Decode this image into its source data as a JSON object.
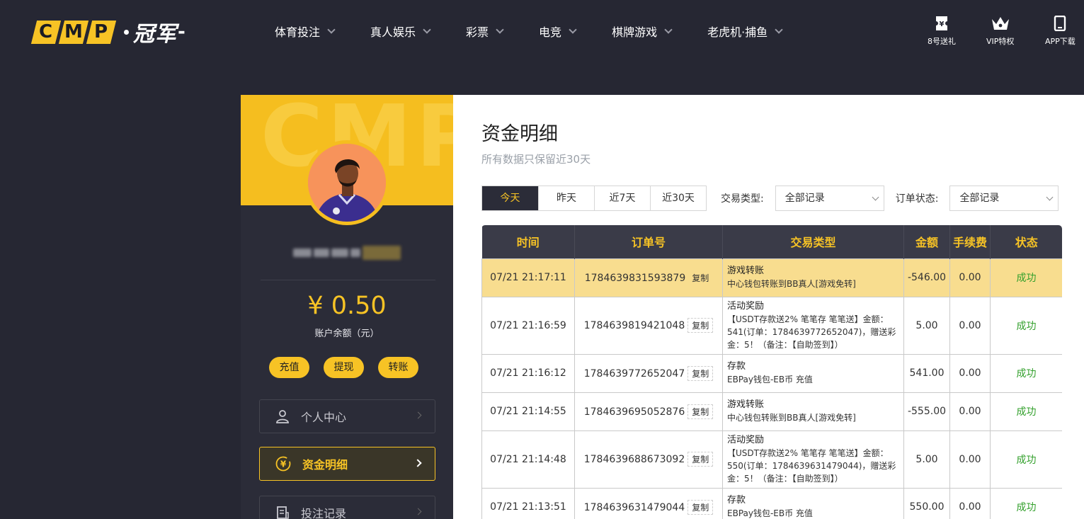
{
  "brand": {
    "letters": [
      "C",
      "M",
      "P"
    ],
    "cn": "冠军"
  },
  "nav": [
    {
      "label": "体育投注"
    },
    {
      "label": "真人娱乐"
    },
    {
      "label": "彩票"
    },
    {
      "label": "电竞"
    },
    {
      "label": "棋牌游戏"
    },
    {
      "label": "老虎机·捕鱼"
    }
  ],
  "quick": {
    "gift": "8号送礼",
    "vip": "VIP特权",
    "app": "APP下载"
  },
  "sidebar": {
    "hero_text": "CMP",
    "balance": "¥ 0.50",
    "balance_label": "账户余额（元）",
    "buttons": {
      "deposit": "充值",
      "withdraw": "提现",
      "transfer": "转账"
    },
    "menu": [
      {
        "label": "个人中心"
      },
      {
        "label": "资金明细"
      },
      {
        "label": "投注记录"
      }
    ]
  },
  "main": {
    "title": "资金明细",
    "subtitle": "所有数据只保留近30天",
    "tabs": [
      "今天",
      "昨天",
      "近7天",
      "近30天"
    ],
    "type_label": "交易类型:",
    "type_value": "全部记录",
    "status_label": "订单状态:",
    "status_value": "全部记录",
    "columns": [
      "时间",
      "订单号",
      "交易类型",
      "金额",
      "手续费",
      "状态"
    ],
    "copy_label": "复制",
    "rows": [
      {
        "time": "07/21 21:17:11",
        "order": "1784639831593879",
        "type": "游戏转账",
        "desc": "中心钱包转账到BB真人[游戏免转]",
        "amount": "-546.00",
        "fee": "0.00",
        "status": "成功"
      },
      {
        "time": "07/21 21:16:59",
        "order": "1784639819421048",
        "type": "活动奖励",
        "desc": "【USDT存款送2% 笔笔存 笔笔送】金额：541(订单：1784639772652047)，赠送彩金：5！（备注：【自助签到】）",
        "amount": "5.00",
        "fee": "0.00",
        "status": "成功"
      },
      {
        "time": "07/21 21:16:12",
        "order": "1784639772652047",
        "type": "存款",
        "desc": "EBPay钱包-EB币 充值",
        "amount": "541.00",
        "fee": "0.00",
        "status": "成功"
      },
      {
        "time": "07/21 21:14:55",
        "order": "1784639695052876",
        "type": "游戏转账",
        "desc": "中心钱包转账到BB真人[游戏免转]",
        "amount": "-555.00",
        "fee": "0.00",
        "status": "成功"
      },
      {
        "time": "07/21 21:14:48",
        "order": "1784639688673092",
        "type": "活动奖励",
        "desc": "【USDT存款送2% 笔笔存 笔笔送】金额：550(订单：1784639631479044)，赠送彩金：5！（备注：【自助签到】）",
        "amount": "5.00",
        "fee": "0.00",
        "status": "成功"
      },
      {
        "time": "07/21 21:13:51",
        "order": "1784639631479044",
        "type": "存款",
        "desc": "EBPay钱包-EB币 充值",
        "amount": "550.00",
        "fee": "0.00",
        "status": "成功"
      }
    ]
  },
  "colors": {
    "accent": "#f7c325",
    "dark": "#262733",
    "success": "#33a02c",
    "highlight_row": "#f8dd8f"
  }
}
